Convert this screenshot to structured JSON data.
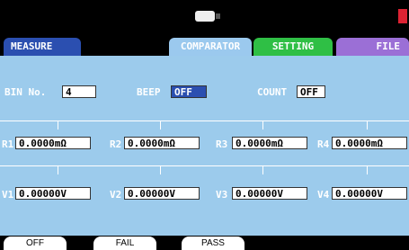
{
  "tabs": {
    "measure": "MEASURE",
    "comparator": "COMPARATOR",
    "setting": "SETTING",
    "file": "FILE"
  },
  "bin": {
    "label": "BIN No.",
    "value": "4"
  },
  "beep": {
    "label": "BEEP",
    "value": "OFF"
  },
  "count": {
    "label": "COUNT",
    "value": "OFF"
  },
  "r": [
    {
      "label": "R1",
      "value": "0.0000mΩ"
    },
    {
      "label": "R2",
      "value": "0.0000mΩ"
    },
    {
      "label": "R3",
      "value": "0.0000mΩ"
    },
    {
      "label": "R4",
      "value": "0.0000mΩ"
    }
  ],
  "v": [
    {
      "label": "V1",
      "value": "0.00000V"
    },
    {
      "label": "V2",
      "value": "0.00000V"
    },
    {
      "label": "V3",
      "value": "0.00000V"
    },
    {
      "label": "V4",
      "value": "0.00000V"
    }
  ],
  "softkeys": [
    "OFF",
    "FAIL",
    "PASS"
  ]
}
